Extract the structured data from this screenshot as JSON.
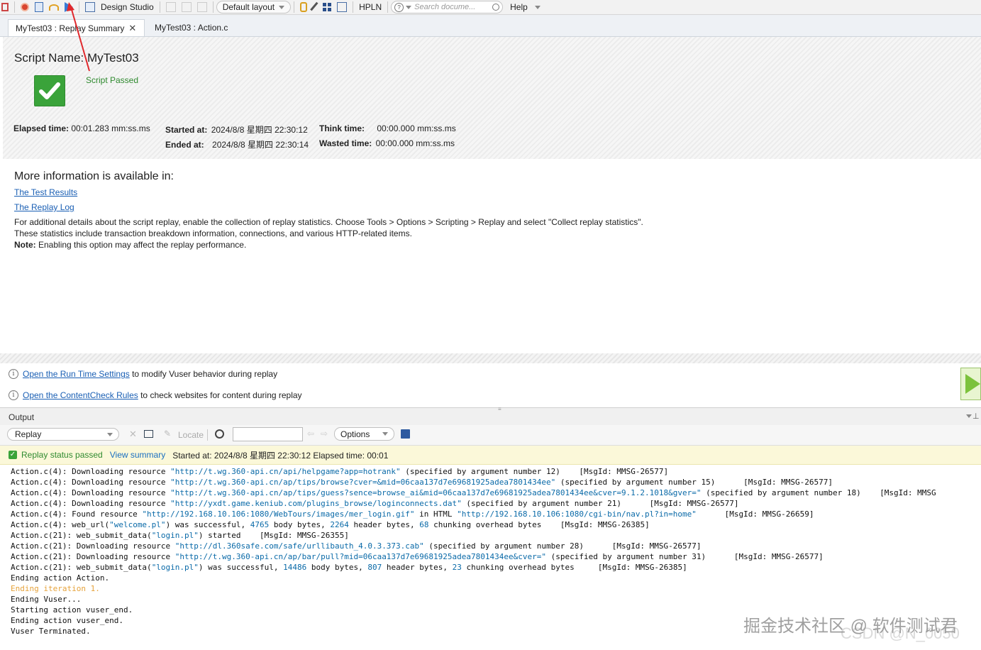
{
  "toolbar": {
    "design_studio": "Design Studio",
    "layout": "Default layout",
    "hpln": "HPLN",
    "search_placeholder": "Search docume...",
    "help": "Help"
  },
  "tabs": [
    {
      "label": "MyTest03 : Replay Summary"
    },
    {
      "label": "MyTest03 : Action.c"
    }
  ],
  "summary": {
    "script_name": "Script Name:  MyTest03",
    "status": "Script Passed",
    "elapsed_label": "Elapsed time:",
    "elapsed_value": "00:01.283 mm:ss.ms",
    "started_label": "Started at:",
    "started_value": "2024/8/8 星期四 22:30:12",
    "ended_label": "Ended at:",
    "ended_value": "2024/8/8 星期四 22:30:14",
    "think_label": "Think time:",
    "think_value": "00:00.000 mm:ss.ms",
    "wasted_label": "Wasted time:",
    "wasted_value": "00:00.000 mm:ss.ms"
  },
  "more_info": {
    "heading": "More information is available in:",
    "link_results": "The Test Results",
    "link_log": "The Replay Log",
    "line1": "For additional details about the script replay, enable the collection of replay statistics. Choose Tools > Options > Scripting > Replay and select \"Collect replay statistics\".",
    "line2": "These statistics include transaction breakdown information, connections, and various HTTP-related items.",
    "note_label": "Note:",
    "note_text": " Enabling this option may affect the replay performance."
  },
  "hints": {
    "rts_link": "Open the Run Time Settings",
    "rts_text": " to modify Vuser behavior during replay",
    "cc_link": "Open the ContentCheck Rules",
    "cc_text": " to check websites for content during replay"
  },
  "output": {
    "title": "Output",
    "source": "Replay",
    "locate": "Locate",
    "options": "Options",
    "status_passed": "Replay status passed",
    "view_summary": "View summary",
    "status_detail": "Started at: 2024/8/8 星期四 22:30:12 Elapsed time: 00:01"
  },
  "log_lines": [
    [
      {
        "t": "Action.c(4): Downloading resource "
      },
      {
        "t": "\"http://t.wg.360-api.cn/api/helpgame?app=hotrank\"",
        "c": "u"
      },
      {
        "t": " (specified by argument number 12)    [MsgId: MMSG-26577]"
      }
    ],
    [
      {
        "t": "Action.c(4): Downloading resource "
      },
      {
        "t": "\"http://t.wg.360-api.cn/ap/tips/browse?cver=&mid=06caa137d7e69681925adea7801434ee\"",
        "c": "u"
      },
      {
        "t": " (specified by argument number 15)      [MsgId: MMSG-26577]"
      }
    ],
    [
      {
        "t": "Action.c(4): Downloading resource "
      },
      {
        "t": "\"http://t.wg.360-api.cn/ap/tips/guess?sence=browse_ai&mid=06caa137d7e69681925adea7801434ee&cver=9.1.2.1018&gver=\"",
        "c": "u"
      },
      {
        "t": " (specified by argument number 18)    [MsgId: MMSG"
      }
    ],
    [
      {
        "t": "Action.c(4): Downloading resource "
      },
      {
        "t": "\"http://yxdt.game.keniub.com/plugins_browse/loginconnects.dat\"",
        "c": "u"
      },
      {
        "t": " (specified by argument number 21)      [MsgId: MMSG-26577]"
      }
    ],
    [
      {
        "t": "Action.c(4): Found resource "
      },
      {
        "t": "\"http://192.168.10.106:1080/WebTours/images/mer_login.gif\"",
        "c": "u"
      },
      {
        "t": " in HTML "
      },
      {
        "t": "\"http://192.168.10.106:1080/cgi-bin/nav.pl?in=home\"",
        "c": "u"
      },
      {
        "t": "      [MsgId: MMSG-26659]"
      }
    ],
    [
      {
        "t": "Action.c(4): web_url("
      },
      {
        "t": "\"welcome.pl\"",
        "c": "u"
      },
      {
        "t": ") was successful, "
      },
      {
        "t": "4765",
        "c": "n"
      },
      {
        "t": " body bytes, "
      },
      {
        "t": "2264",
        "c": "n"
      },
      {
        "t": " header bytes, "
      },
      {
        "t": "68",
        "c": "n"
      },
      {
        "t": " chunking overhead bytes    [MsgId: MMSG-26385]"
      }
    ],
    [
      {
        "t": "Action.c(21): web_submit_data("
      },
      {
        "t": "\"login.pl\"",
        "c": "u"
      },
      {
        "t": ") started    [MsgId: MMSG-26355]"
      }
    ],
    [
      {
        "t": "Action.c(21): Downloading resource "
      },
      {
        "t": "\"http://dl.360safe.com/safe/urllibauth_4.0.3.373.cab\"",
        "c": "u"
      },
      {
        "t": " (specified by argument number 28)      [MsgId: MMSG-26577]"
      }
    ],
    [
      {
        "t": "Action.c(21): Downloading resource "
      },
      {
        "t": "\"http://t.wg.360-api.cn/ap/bar/pull?mid=06caa137d7e69681925adea7801434ee&cver=\"",
        "c": "u"
      },
      {
        "t": " (specified by argument number 31)      [MsgId: MMSG-26577]"
      }
    ],
    [
      {
        "t": "Action.c(21): web_submit_data("
      },
      {
        "t": "\"login.pl\"",
        "c": "u"
      },
      {
        "t": ") was successful, "
      },
      {
        "t": "14486",
        "c": "n"
      },
      {
        "t": " body bytes, "
      },
      {
        "t": "807",
        "c": "n"
      },
      {
        "t": " header bytes, "
      },
      {
        "t": "23",
        "c": "n"
      },
      {
        "t": " chunking overhead bytes     [MsgId: MMSG-26385]"
      }
    ],
    [
      {
        "t": "Ending action Action."
      }
    ],
    [
      {
        "t": "Ending iteration 1.",
        "c": "orange"
      }
    ],
    [
      {
        "t": "Ending Vuser..."
      }
    ],
    [
      {
        "t": "Starting action vuser_end."
      }
    ],
    [
      {
        "t": "Ending action vuser_end."
      }
    ],
    [
      {
        "t": "Vuser Terminated."
      }
    ]
  ],
  "watermark": "掘金技术社区 @ 软件测试君",
  "watermark2": "CSDN @N_0050"
}
